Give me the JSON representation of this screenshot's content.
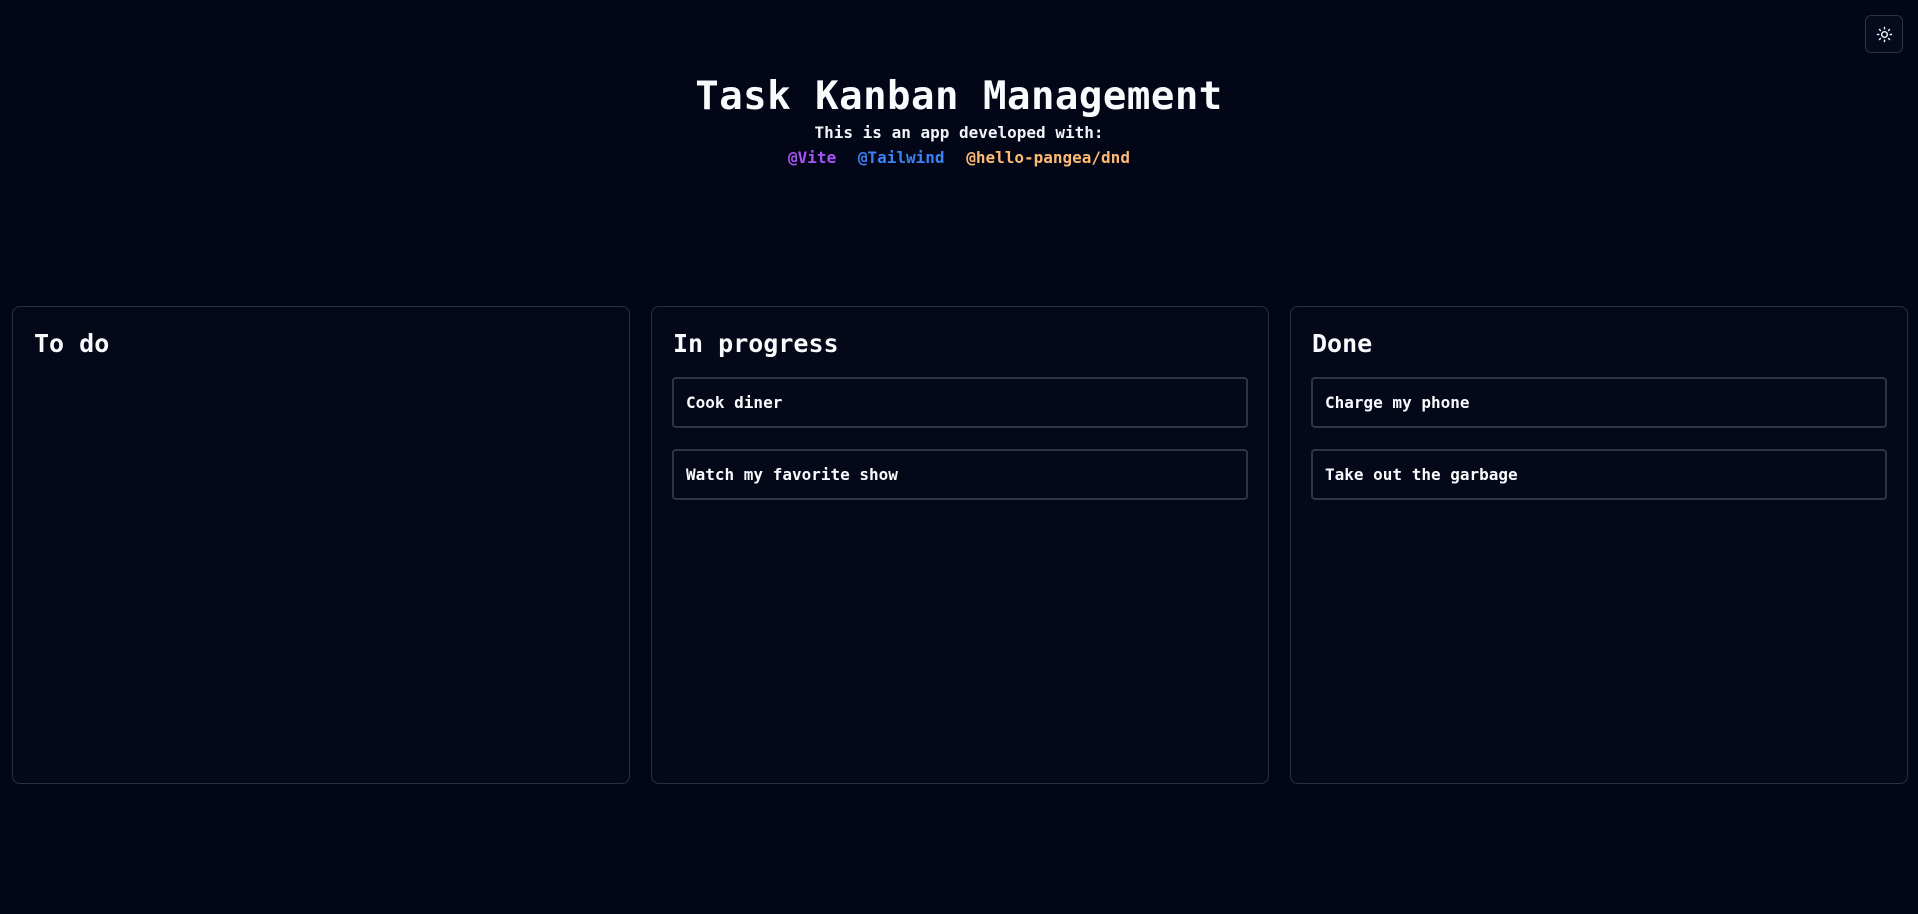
{
  "header": {
    "title": "Task Kanban Management",
    "subtitle": "This is an app developed with:",
    "tech": [
      {
        "label": "@Vite",
        "color": "#a855f7"
      },
      {
        "label": "@Tailwind",
        "color": "#3b82f6"
      },
      {
        "label": "@hello-pangea/dnd",
        "color": "#fdba74"
      }
    ]
  },
  "theme_toggle": {
    "icon": "sun-icon"
  },
  "columns": [
    {
      "title": "To do",
      "cards": []
    },
    {
      "title": "In progress",
      "cards": [
        {
          "label": "Cook diner"
        },
        {
          "label": "Watch my favorite show"
        }
      ]
    },
    {
      "title": "Done",
      "cards": [
        {
          "label": "Charge my phone"
        },
        {
          "label": "Take out the garbage"
        }
      ]
    }
  ],
  "colors": {
    "background": "#030617",
    "border": "#293140",
    "text": "#f8fafc"
  }
}
